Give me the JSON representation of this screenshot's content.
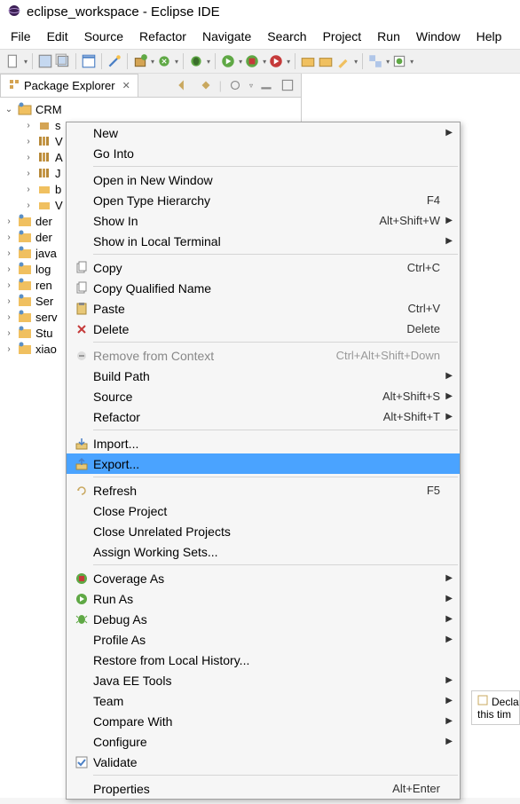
{
  "window": {
    "title": "eclipse_workspace - Eclipse IDE"
  },
  "menubar": [
    "File",
    "Edit",
    "Source",
    "Refactor",
    "Navigate",
    "Search",
    "Project",
    "Run",
    "Window",
    "Help"
  ],
  "explorer": {
    "tab_title": "Package Explorer",
    "tree": {
      "root": {
        "label": "CRM",
        "expanded": true
      },
      "children": [
        {
          "label": "s",
          "icon": "package"
        },
        {
          "label": "V",
          "icon": "lib"
        },
        {
          "label": "A",
          "icon": "lib"
        },
        {
          "label": "J",
          "icon": "lib"
        },
        {
          "label": "b",
          "icon": "folder"
        },
        {
          "label": "V",
          "icon": "folder"
        }
      ],
      "siblings": [
        {
          "label": "der"
        },
        {
          "label": "der"
        },
        {
          "label": "java"
        },
        {
          "label": "log"
        },
        {
          "label": "ren"
        },
        {
          "label": "Ser"
        },
        {
          "label": "serv"
        },
        {
          "label": "Stu"
        },
        {
          "label": "xiao"
        }
      ]
    }
  },
  "context_menu": {
    "groups": [
      [
        {
          "label": "New",
          "arrow": true
        },
        {
          "label": "Go Into"
        }
      ],
      [
        {
          "label": "Open in New Window"
        },
        {
          "label": "Open Type Hierarchy",
          "shortcut": "F4"
        },
        {
          "label": "Show In",
          "shortcut": "Alt+Shift+W",
          "arrow": true
        },
        {
          "label": "Show in Local Terminal",
          "arrow": true
        }
      ],
      [
        {
          "label": "Copy",
          "shortcut": "Ctrl+C",
          "icon": "copy"
        },
        {
          "label": "Copy Qualified Name",
          "icon": "copy-q"
        },
        {
          "label": "Paste",
          "shortcut": "Ctrl+V",
          "icon": "paste"
        },
        {
          "label": "Delete",
          "shortcut": "Delete",
          "icon": "delete"
        }
      ],
      [
        {
          "label": "Remove from Context",
          "shortcut": "Ctrl+Alt+Shift+Down",
          "icon": "remove",
          "disabled": true
        },
        {
          "label": "Build Path",
          "arrow": true
        },
        {
          "label": "Source",
          "shortcut": "Alt+Shift+S",
          "arrow": true
        },
        {
          "label": "Refactor",
          "shortcut": "Alt+Shift+T",
          "arrow": true
        }
      ],
      [
        {
          "label": "Import...",
          "icon": "import"
        },
        {
          "label": "Export...",
          "icon": "export",
          "highlight": true
        }
      ],
      [
        {
          "label": "Refresh",
          "shortcut": "F5",
          "icon": "refresh"
        },
        {
          "label": "Close Project"
        },
        {
          "label": "Close Unrelated Projects"
        },
        {
          "label": "Assign Working Sets..."
        }
      ],
      [
        {
          "label": "Coverage As",
          "icon": "coverage",
          "arrow": true
        },
        {
          "label": "Run As",
          "icon": "run",
          "arrow": true
        },
        {
          "label": "Debug As",
          "icon": "debug",
          "arrow": true
        },
        {
          "label": "Profile As",
          "arrow": true
        },
        {
          "label": "Restore from Local History..."
        },
        {
          "label": "Java EE Tools",
          "arrow": true
        },
        {
          "label": "Team",
          "arrow": true
        },
        {
          "label": "Compare With",
          "arrow": true
        },
        {
          "label": "Configure",
          "arrow": true
        },
        {
          "label": "Validate",
          "icon": "validate"
        }
      ],
      [
        {
          "label": "Properties",
          "shortcut": "Alt+Enter"
        }
      ]
    ]
  },
  "side_popup": {
    "line1": "Decla",
    "line2": "this tim"
  }
}
